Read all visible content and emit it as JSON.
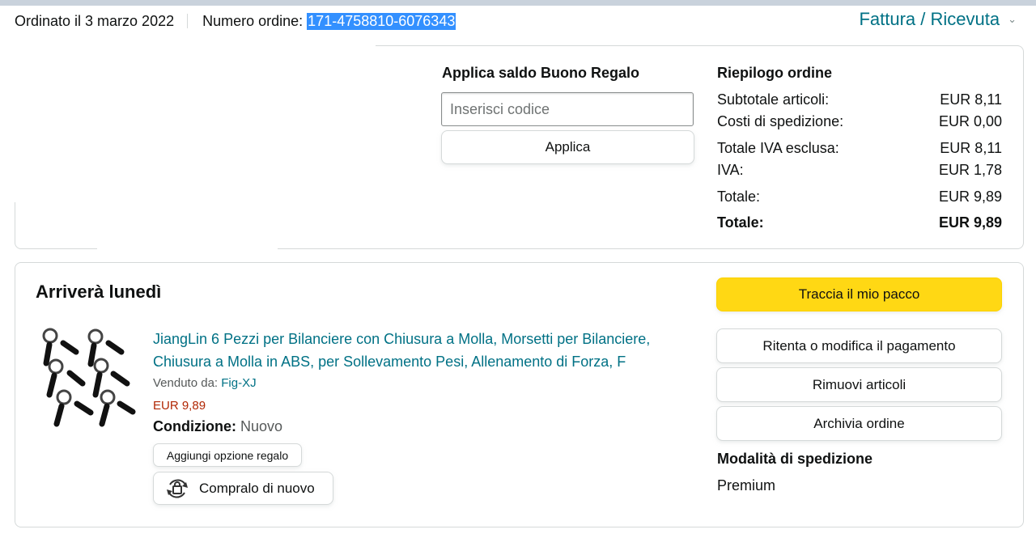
{
  "header": {
    "ordered_label": "Ordinato il 3 marzo 2022",
    "order_number_label": "Numero ordine:",
    "order_number": "171-4758810-6076343",
    "invoice_link": "Fattura / Ricevuta"
  },
  "gift_card": {
    "title": "Applica saldo Buono Regalo",
    "placeholder": "Inserisci codice",
    "apply_label": "Applica"
  },
  "summary": {
    "title": "Riepilogo ordine",
    "rows": [
      {
        "label": "Subtotale articoli:",
        "value": "EUR 8,11"
      },
      {
        "label": "Costi di spedizione:",
        "value": "EUR 0,00"
      },
      {
        "label": "Totale IVA esclusa:",
        "value": "EUR 8,11"
      },
      {
        "label": "IVA:",
        "value": "EUR 1,78"
      },
      {
        "label": "Totale:",
        "value": "EUR 9,89"
      },
      {
        "label": "Totale:",
        "value": "EUR 9,89"
      }
    ]
  },
  "shipment": {
    "arrival": "Arriverà lunedì",
    "product": {
      "title": "JiangLin 6 Pezzi per Bilanciere con Chiusura a Molla, Morsetti per Bilanciere, Chiusura a Molla in ABS, per Sollevamento Pesi, Allenamento di Forza, F",
      "sold_by_label": "Venduto da:",
      "seller": "Fig-XJ",
      "price": "EUR 9,89",
      "condition_label": "Condizione:",
      "condition_value": "Nuovo",
      "gift_option_label": "Aggiungi opzione regalo",
      "buy_again_label": "Compralo di nuovo"
    },
    "actions": {
      "track": "Traccia il mio pacco",
      "retry_payment": "Ritenta o modifica il pagamento",
      "remove_items": "Rimuovi articoli",
      "archive": "Archivia ordine"
    },
    "shipping_mode_label": "Modalità di spedizione",
    "shipping_mode_value": "Premium"
  },
  "colors": {
    "link": "#007185",
    "price": "#b12704",
    "primary_button": "#ffd814",
    "selection": "#3390ff"
  }
}
